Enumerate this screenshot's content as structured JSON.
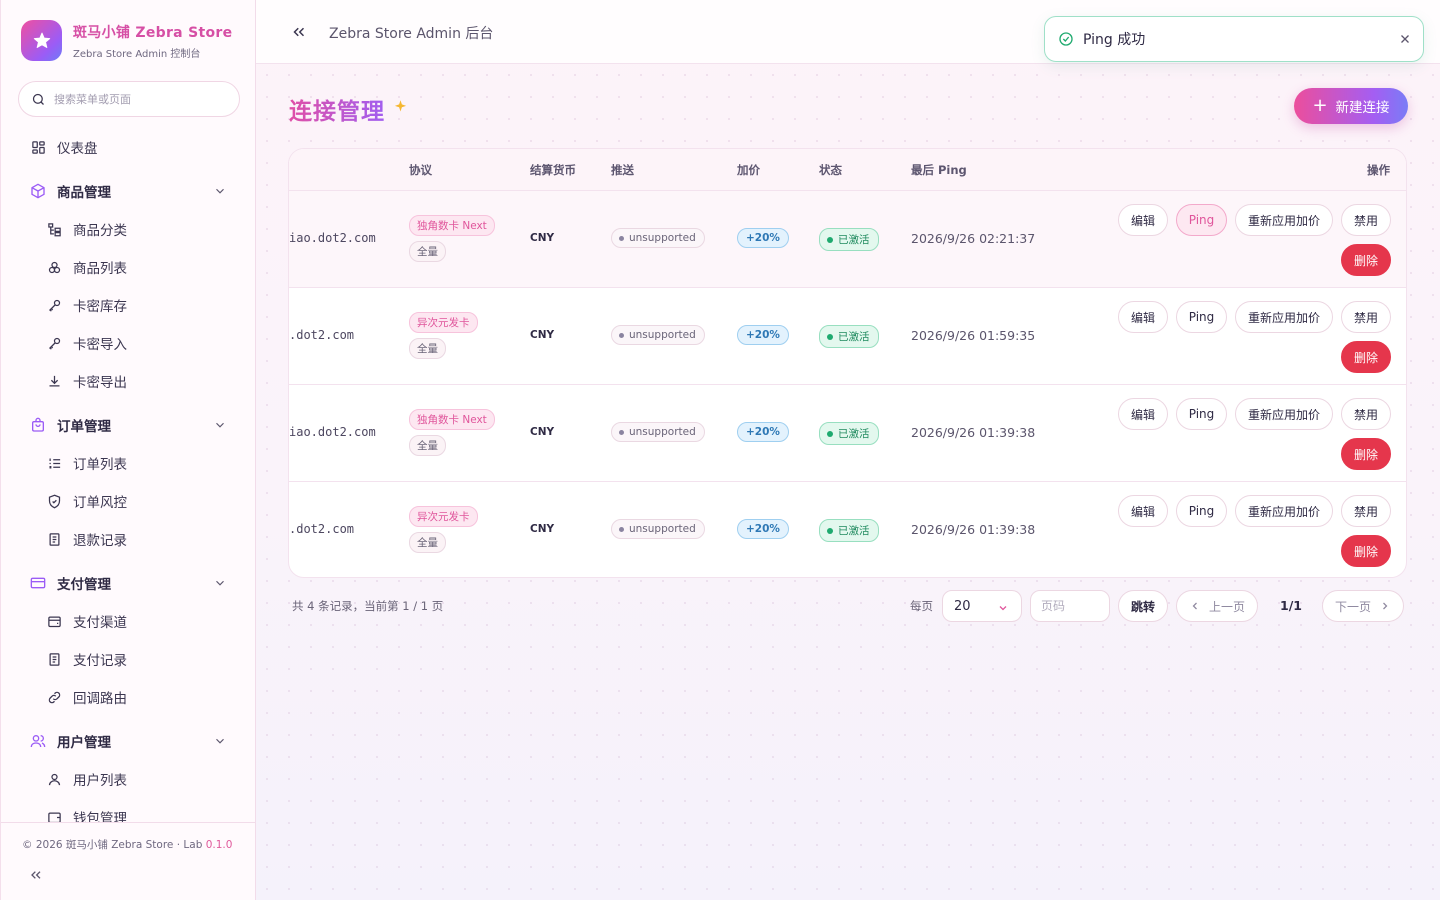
{
  "brand": {
    "title": "斑马小铺 Zebra Store",
    "subtitle": "Zebra Store Admin 控制台"
  },
  "search": {
    "placeholder": "搜索菜单或页面"
  },
  "nav": {
    "dashboard": "仪表盘",
    "products": {
      "label": "商品管理",
      "items": [
        "商品分类",
        "商品列表",
        "卡密库存",
        "卡密导入",
        "卡密导出"
      ]
    },
    "orders": {
      "label": "订单管理",
      "items": [
        "订单列表",
        "订单风控",
        "退款记录"
      ]
    },
    "payments": {
      "label": "支付管理",
      "items": [
        "支付渠道",
        "支付记录",
        "回调路由"
      ]
    },
    "users": {
      "label": "用户管理",
      "items": [
        "用户列表",
        "钱包管理"
      ]
    }
  },
  "footer": {
    "copyright": "© 2026 斑马小铺 Zebra Store · Lab ",
    "version": "0.1.0"
  },
  "header": {
    "title": "Zebra Store Admin 后台"
  },
  "toast": {
    "message": "Ping 成功"
  },
  "page": {
    "title": "连接管理",
    "new_button": "新建连接"
  },
  "table": {
    "headers": {
      "protocol": "协议",
      "currency": "结算货币",
      "push": "推送",
      "markup": "加价",
      "status": "状态",
      "last_ping": "最后 Ping",
      "actions": "操作"
    },
    "rows": [
      {
        "url": "iao.dot2.com",
        "protocol": "独角数卡 Next",
        "scope": "全量",
        "currency": "CNY",
        "push": "unsupported",
        "markup": "+20%",
        "status": "已激活",
        "last_ping": "2026/9/26 02:21:37"
      },
      {
        "url": ".dot2.com",
        "protocol": "异次元发卡",
        "scope": "全量",
        "currency": "CNY",
        "push": "unsupported",
        "markup": "+20%",
        "status": "已激活",
        "last_ping": "2026/9/26 01:59:35"
      },
      {
        "url": "iao.dot2.com",
        "protocol": "独角数卡 Next",
        "scope": "全量",
        "currency": "CNY",
        "push": "unsupported",
        "markup": "+20%",
        "status": "已激活",
        "last_ping": "2026/9/26 01:39:38"
      },
      {
        "url": ".dot2.com",
        "protocol": "异次元发卡",
        "scope": "全量",
        "currency": "CNY",
        "push": "unsupported",
        "markup": "+20%",
        "status": "已激活",
        "last_ping": "2026/9/26 01:39:38"
      }
    ],
    "actions": {
      "edit": "编辑",
      "ping": "Ping",
      "reapply": "重新应用加价",
      "disable": "禁用",
      "delete": "删除"
    }
  },
  "pagination": {
    "summary": "共 4 条记录，当前第 1 / 1 页",
    "per_page_label": "每页",
    "per_page_value": "20",
    "page_placeholder": "页码",
    "jump": "跳转",
    "prev": "上一页",
    "indicator": "1/1",
    "next": "下一页"
  },
  "colors": {
    "accent_pink": "#e04fa6",
    "accent_purple": "#a15ef0",
    "danger": "#e5364c",
    "success": "#1faa6f"
  }
}
